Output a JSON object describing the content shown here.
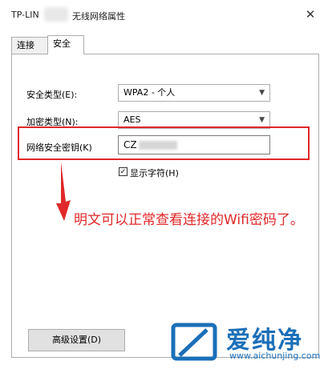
{
  "window": {
    "title_left": "TP-LIN",
    "title_right": "无线网络属性",
    "close_glyph": "✕"
  },
  "tabs": [
    {
      "label": "连接",
      "active": false
    },
    {
      "label": "安全",
      "active": true
    }
  ],
  "security": {
    "type_label": "安全类型(E):",
    "type_value": "WPA2 - 个人",
    "encryption_label": "加密类型(N):",
    "encryption_value": "AES",
    "key_label": "网络安全密钥(K)",
    "key_value": "CZ",
    "show_chars_label": "显示字符(H)",
    "show_chars_checked": true
  },
  "annotation": "明文可以正常查看连接的Wifi密码了。",
  "advanced_button": "高级设置(D)",
  "watermark": {
    "text": "爱纯净",
    "url": "www.aichunjing.com"
  },
  "colors": {
    "highlight": "#e0282a",
    "watermark": "#1b6fb8"
  }
}
